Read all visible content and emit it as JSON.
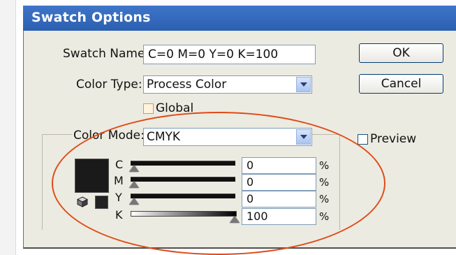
{
  "dialog": {
    "title": "Swatch Options",
    "swatch_name_label": "Swatch Name:",
    "swatch_name_value": "C=0 M=0 Y=0 K=100",
    "color_type_label": "Color Type:",
    "color_type_value": "Process Color",
    "global_label": "Global",
    "color_mode_label": "Color Mode:",
    "color_mode_value": "CMYK",
    "preview_label": "Preview",
    "ok_label": "OK",
    "cancel_label": "Cancel"
  },
  "channels": [
    {
      "label": "C",
      "value": "0",
      "unit": "%",
      "level": 0
    },
    {
      "label": "M",
      "value": "0",
      "unit": "%",
      "level": 0
    },
    {
      "label": "Y",
      "value": "0",
      "unit": "%",
      "level": 0
    },
    {
      "label": "K",
      "value": "100",
      "unit": "%",
      "level": 1
    }
  ],
  "colors": {
    "title_bar": "#2b5fb0",
    "swatch": "#1a1a1a",
    "annotation": "#e04a18"
  },
  "icons": [
    "dropdown-arrow-icon",
    "out-of-web-gamut-cube-icon",
    "checkbox-icon"
  ]
}
